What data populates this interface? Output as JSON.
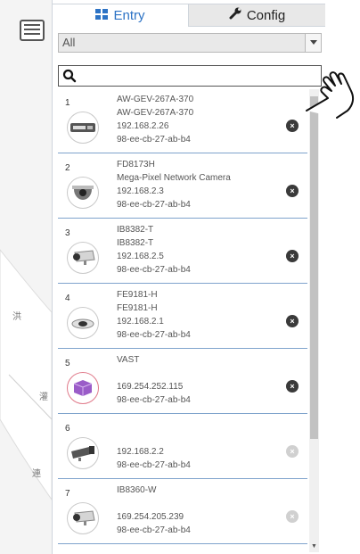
{
  "tabs": [
    {
      "label": "Entry",
      "icon": "grid-icon",
      "active": true,
      "color": "#2d73c5"
    },
    {
      "label": "Config",
      "icon": "wrench-icon",
      "active": false
    }
  ],
  "filter": {
    "selected": "All"
  },
  "search": {
    "value": "",
    "placeholder": ""
  },
  "devices": [
    {
      "index": "1",
      "lines": [
        "AW-GEV-267A-370",
        "AW-GEV-267A-370",
        "192.168.2.26",
        "98-ee-cb-27-ab-b4"
      ],
      "icon": "switch-icon",
      "removable": true
    },
    {
      "index": "2",
      "lines": [
        "FD8173H",
        "Mega-Pixel Network Camera",
        "192.168.2.3",
        "98-ee-cb-27-ab-b4"
      ],
      "icon": "dome-camera-icon",
      "removable": true
    },
    {
      "index": "3",
      "lines": [
        "IB8382-T",
        "IB8382-T",
        "192.168.2.5",
        "98-ee-cb-27-ab-b4"
      ],
      "icon": "bullet-camera-icon",
      "removable": true
    },
    {
      "index": "4",
      "lines": [
        "FE9181-H",
        "FE9181-H",
        "192.168.2.1",
        "98-ee-cb-27-ab-b4"
      ],
      "icon": "fisheye-camera-icon",
      "removable": true
    },
    {
      "index": "5",
      "lines": [
        "VAST",
        "",
        "169.254.252.115",
        "98-ee-cb-27-ab-b4"
      ],
      "icon": "vast-server-icon",
      "removable": true
    },
    {
      "index": "6",
      "lines": [
        "",
        "",
        "192.168.2.2",
        "98-ee-cb-27-ab-b4"
      ],
      "icon": "box-camera-icon",
      "removable": false
    },
    {
      "index": "7",
      "lines": [
        "IB8360-W",
        "",
        "169.254.205.239",
        "98-ee-cb-27-ab-b4"
      ],
      "icon": "bullet-camera-icon",
      "removable": false
    }
  ],
  "remove_glyph": "×",
  "map_labels": [
    "洪",
    "灌",
    "連"
  ]
}
